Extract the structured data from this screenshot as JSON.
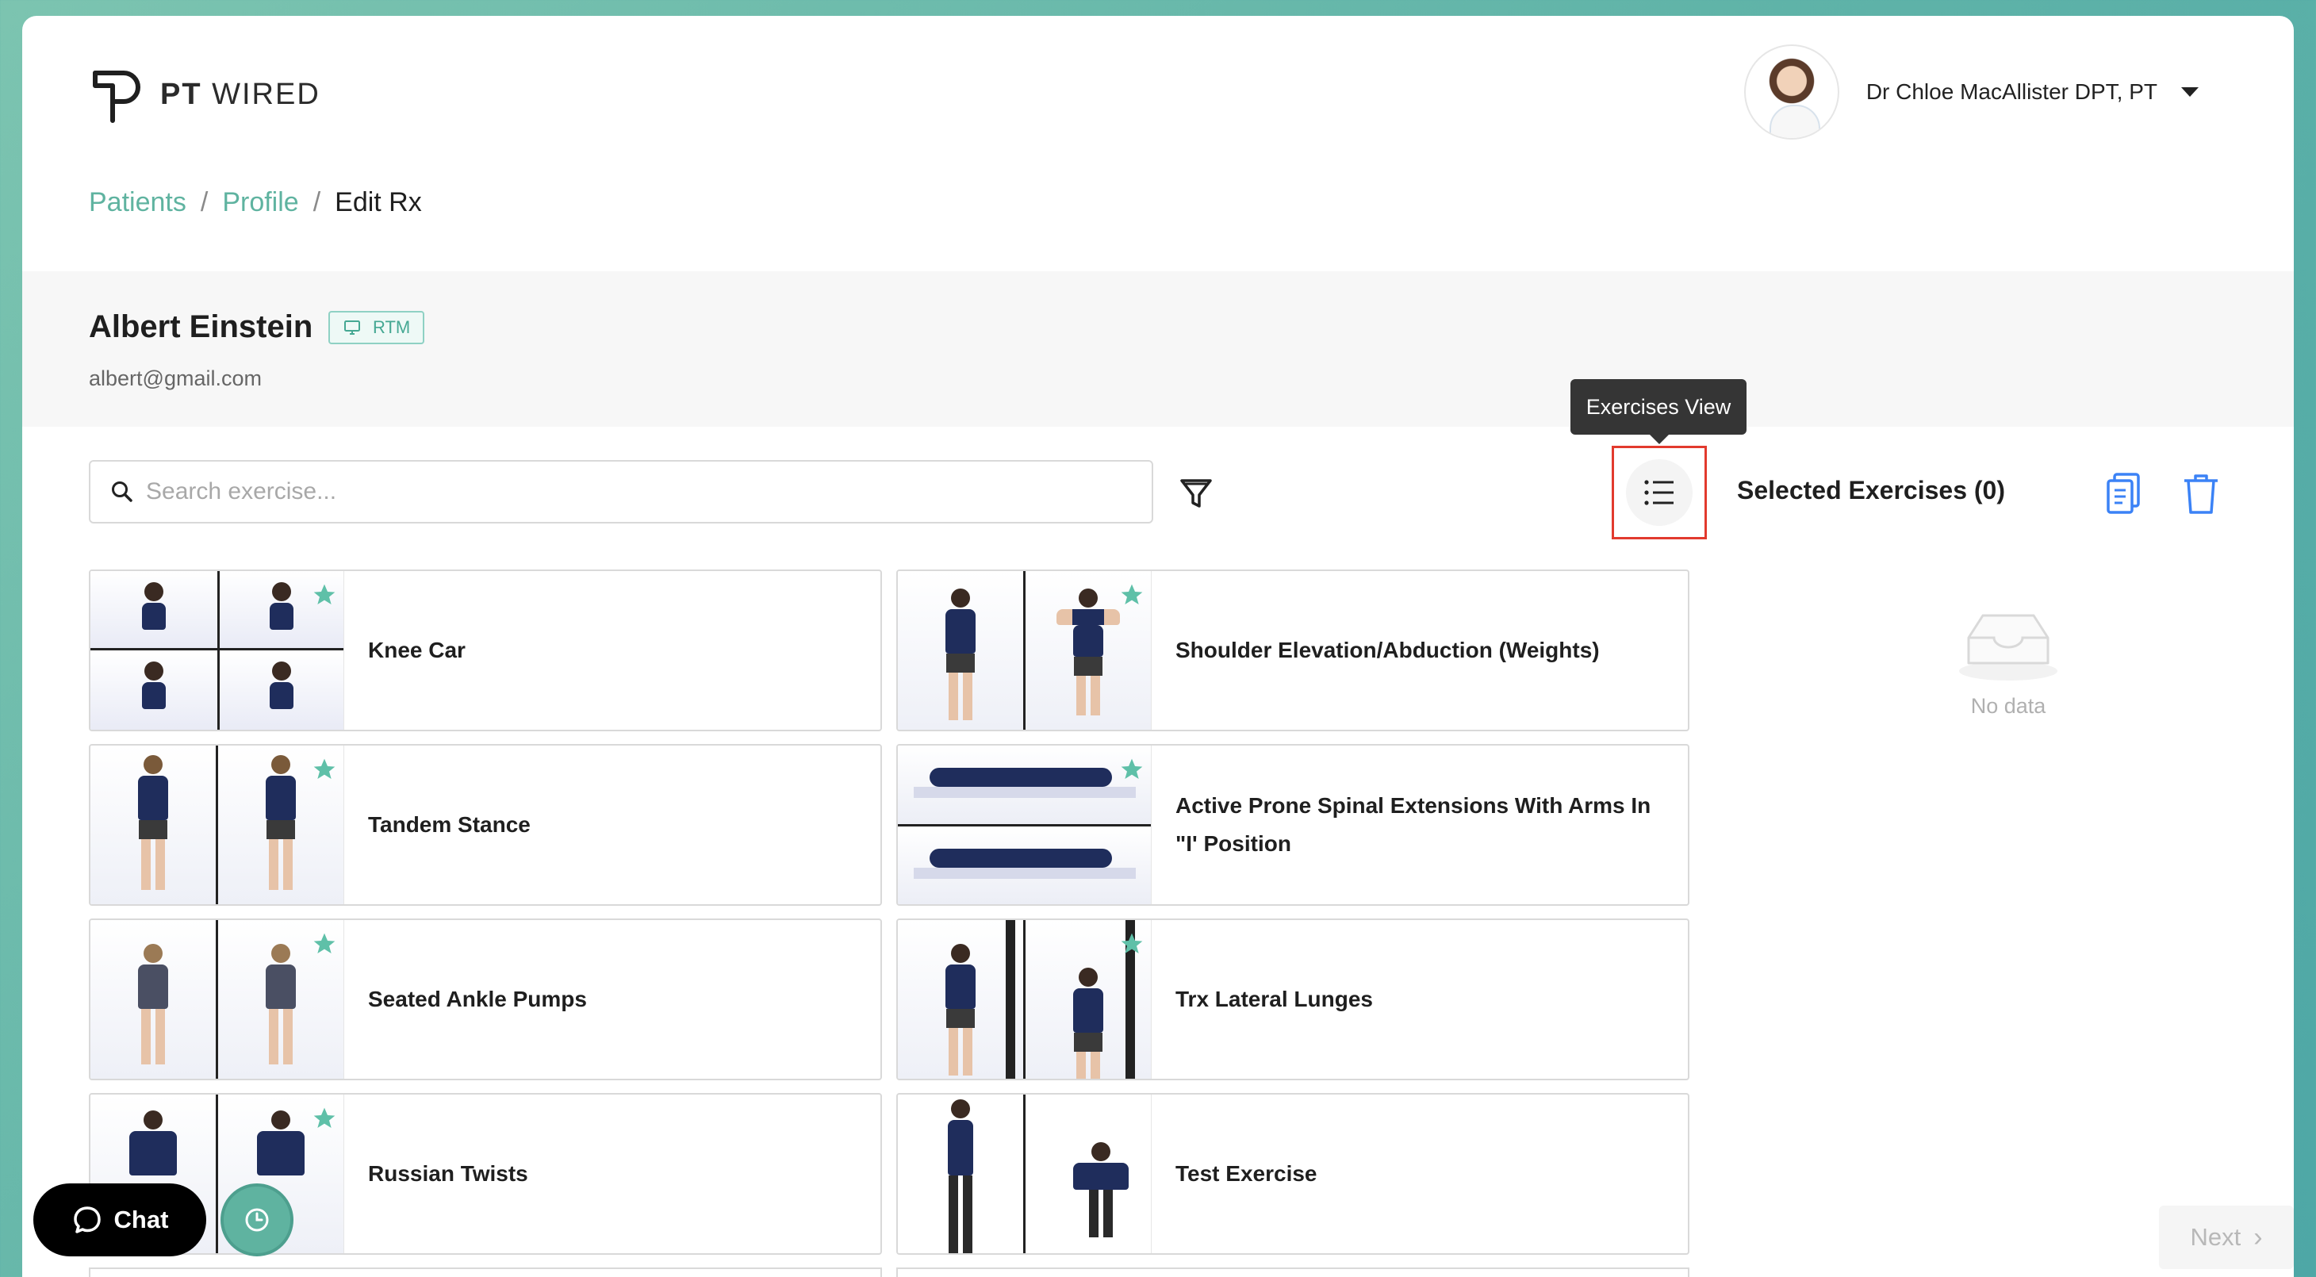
{
  "app": {
    "logo_bold": "PT",
    "logo_light": "WIRED"
  },
  "user": {
    "name": "Dr Chloe MacAllister DPT, PT"
  },
  "breadcrumb": {
    "items": [
      "Patients",
      "Profile",
      "Edit Rx"
    ],
    "separator": "/"
  },
  "patient": {
    "name": "Albert Einstein",
    "badge": "RTM",
    "email": "albert@gmail.com"
  },
  "search": {
    "placeholder": "Search exercise...",
    "value": ""
  },
  "view_toggle": {
    "tooltip": "Exercises View"
  },
  "selected": {
    "title": "Selected Exercises (0)",
    "empty_text": "No data"
  },
  "exercises": [
    {
      "label": "Knee Car"
    },
    {
      "label": "Shoulder Elevation/Abduction (Weights)"
    },
    {
      "label": "Tandem Stance"
    },
    {
      "label": "Active Prone Spinal Extensions With Arms In \"I' Position"
    },
    {
      "label": "Seated Ankle Pumps"
    },
    {
      "label": "Trx Lateral Lunges"
    },
    {
      "label": "Russian Twists"
    },
    {
      "label": "Test Exercise"
    }
  ],
  "chat": {
    "label": "Chat"
  },
  "next": {
    "label": "Next"
  },
  "colors": {
    "accent": "#5fb3a0",
    "highlight_border": "#e23a2e",
    "icon_blue": "#3b82f6",
    "star": "#5fc0a8"
  }
}
